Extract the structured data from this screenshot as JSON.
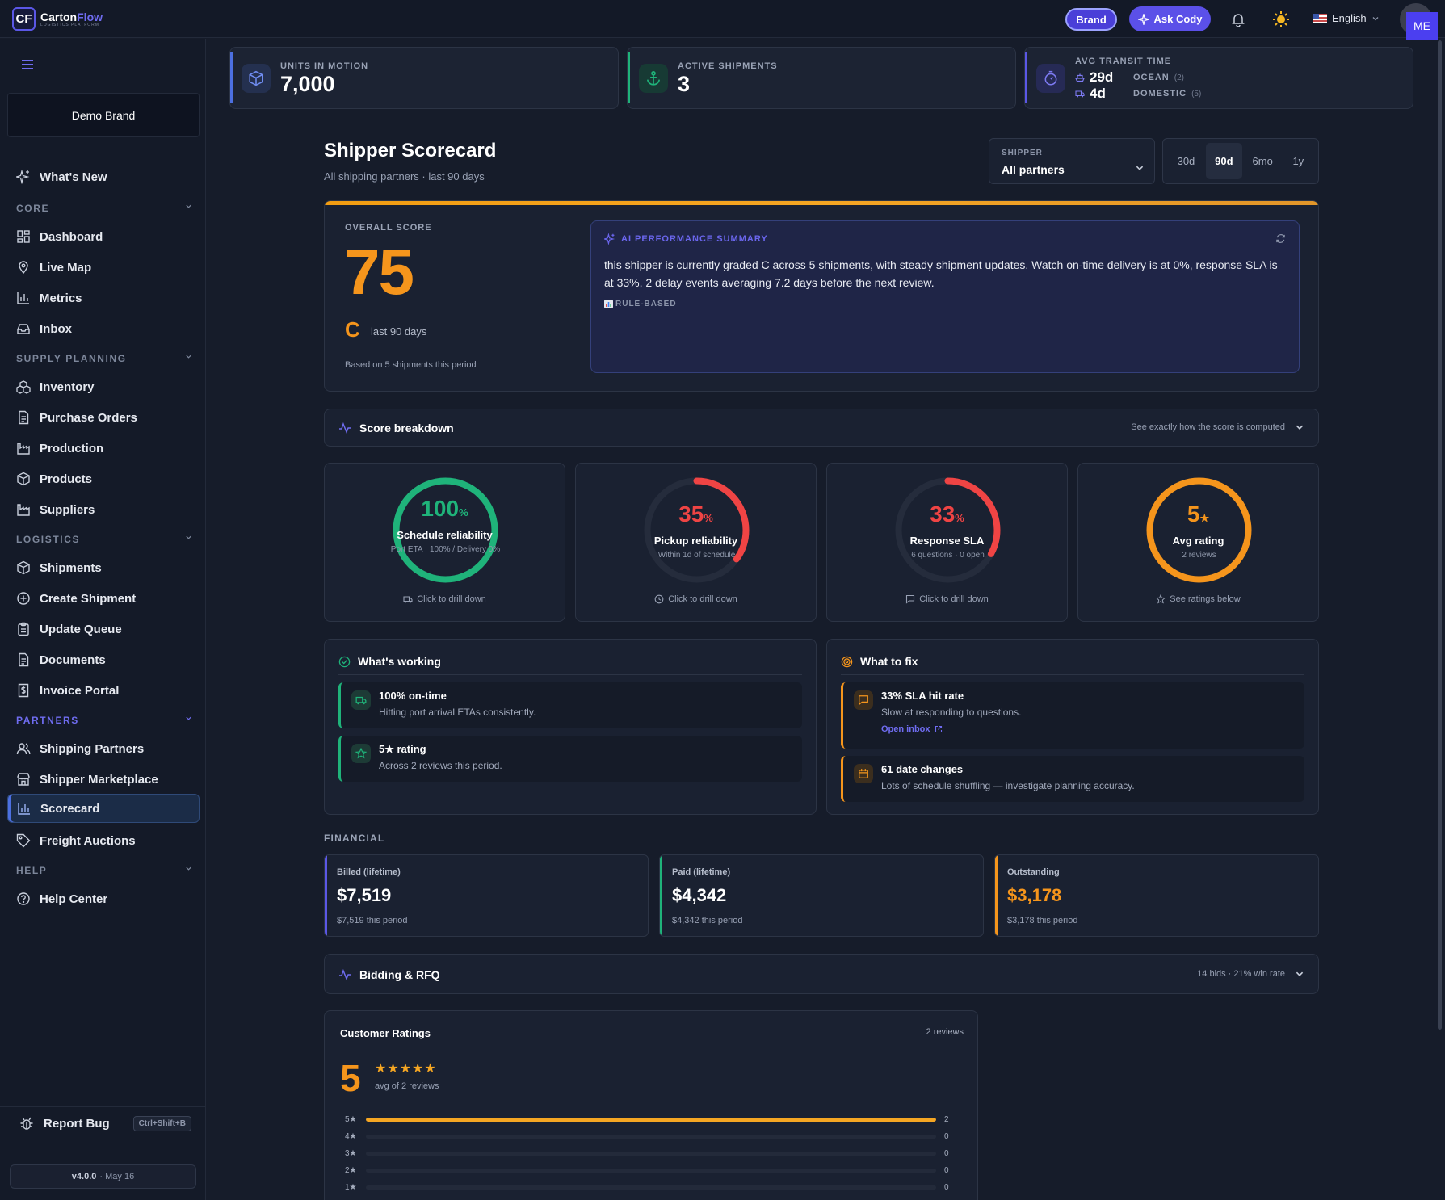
{
  "header": {
    "logo_mark": "CF",
    "logo_name_a": "Carton",
    "logo_name_b": "Flow",
    "logo_tagline": "LOGISTICS PLATFORM",
    "brand_button": "Brand",
    "ask_button": "Ask Cody",
    "language": "English",
    "user_initials": "ME"
  },
  "sidebar": {
    "brand_name": "Demo Brand",
    "whats_new": "What's New",
    "sections": {
      "core": "CORE",
      "supply": "SUPPLY PLANNING",
      "logistics": "LOGISTICS",
      "partners": "PARTNERS",
      "help": "HELP"
    },
    "items": {
      "dashboard": "Dashboard",
      "live_map": "Live Map",
      "metrics": "Metrics",
      "inbox": "Inbox",
      "inventory": "Inventory",
      "purchase_orders": "Purchase Orders",
      "production": "Production",
      "products": "Products",
      "suppliers": "Suppliers",
      "shipments": "Shipments",
      "create_shipment": "Create Shipment",
      "update_queue": "Update Queue",
      "documents": "Documents",
      "invoice_portal": "Invoice Portal",
      "shipping_partners": "Shipping Partners",
      "shipper_marketplace": "Shipper Marketplace",
      "scorecard": "Scorecard",
      "freight_auctions": "Freight Auctions",
      "help_center": "Help Center"
    },
    "report_bug": "Report Bug",
    "report_shortcut": "Ctrl+Shift+B",
    "version": "v4.0.0",
    "version_date": "· May 16"
  },
  "kpis": {
    "units_label": "UNITS IN MOTION",
    "units_value": "7,000",
    "shipments_label": "ACTIVE SHIPMENTS",
    "shipments_value": "3",
    "transit_label": "AVG TRANSIT TIME",
    "ocean_value": "29d",
    "ocean_label": "OCEAN",
    "ocean_count": "(2)",
    "domestic_value": "4d",
    "domestic_label": "DOMESTIC",
    "domestic_count": "(5)"
  },
  "page": {
    "title": "Shipper Scorecard",
    "subtitle": "All shipping partners · last 90 days",
    "shipper_label": "SHIPPER",
    "shipper_value": "All partners",
    "ranges": [
      "30d",
      "90d",
      "6mo",
      "1y"
    ],
    "selected_range": "90d"
  },
  "overall": {
    "label": "OVERALL SCORE",
    "score": "75",
    "grade": "C",
    "period": "last 90 days",
    "basis": "Based on 5 shipments this period"
  },
  "ai_summary": {
    "heading": "AI PERFORMANCE SUMMARY",
    "text": "this shipper is currently graded C across 5 shipments, with steady shipment updates. Watch on-time delivery is at 0%, response SLA is at 33%, 2 delay events averaging 7.2 days before the next review.",
    "tag": "RULE-BASED"
  },
  "breakdown": {
    "title": "Score breakdown",
    "hint": "See exactly how the score is computed"
  },
  "gauges": [
    {
      "value": "100",
      "unit": "%",
      "fraction": 1.0,
      "name": "Schedule reliability",
      "sub": "Port ETA · 100% / Delivery 0%",
      "foot": "Click to drill down",
      "color": "#1fb37a"
    },
    {
      "value": "35",
      "unit": "%",
      "fraction": 0.35,
      "name": "Pickup reliability",
      "sub": "Within 1d of schedule",
      "foot": "Click to drill down",
      "color": "#ef4444"
    },
    {
      "value": "33",
      "unit": "%",
      "fraction": 0.33,
      "name": "Response SLA",
      "sub": "6 questions · 0 open",
      "foot": "Click to drill down",
      "color": "#ef4444"
    },
    {
      "value": "5",
      "unit": "★",
      "fraction": 1.0,
      "name": "Avg rating",
      "sub": "2 reviews",
      "foot": "See ratings below",
      "color": "#f5951c"
    }
  ],
  "working": {
    "title": "What's working",
    "items": [
      {
        "title": "100% on-time",
        "desc": "Hitting port arrival ETAs consistently."
      },
      {
        "title": "5★ rating",
        "desc": "Across 2 reviews this period."
      }
    ]
  },
  "fix": {
    "title": "What to fix",
    "items": [
      {
        "title": "33% SLA hit rate",
        "desc": "Slow at responding to questions.",
        "link": "Open inbox"
      },
      {
        "title": "61 date changes",
        "desc": "Lots of schedule shuffling — investigate planning accuracy."
      }
    ]
  },
  "financial": {
    "section": "FINANCIAL",
    "cards": [
      {
        "label": "Billed (lifetime)",
        "value": "$7,519",
        "period": "$7,519 this period",
        "color": "#5b57e6"
      },
      {
        "label": "Paid (lifetime)",
        "value": "$4,342",
        "period": "$4,342 this period",
        "color": "#1fb37a"
      },
      {
        "label": "Outstanding",
        "value": "$3,178",
        "period": "$3,178 this period",
        "color": "#f5951c"
      }
    ]
  },
  "bidding": {
    "title": "Bidding & RFQ",
    "summary": "14 bids · 21% win rate"
  },
  "ratings": {
    "title": "Customer Ratings",
    "count": "2 reviews",
    "average": "5",
    "stars": "★★★★★",
    "avg_text": "avg of 2 reviews",
    "rows": [
      {
        "label": "5★",
        "count": "2",
        "fraction": 1.0
      },
      {
        "label": "4★",
        "count": "0",
        "fraction": 0
      },
      {
        "label": "3★",
        "count": "0",
        "fraction": 0
      },
      {
        "label": "2★",
        "count": "0",
        "fraction": 0
      },
      {
        "label": "1★",
        "count": "0",
        "fraction": 0
      }
    ]
  },
  "colors": {
    "accent": "#5b57e6",
    "orange": "#f5951c",
    "green": "#1fb37a",
    "red": "#ef4444",
    "background": "#161c2a"
  }
}
